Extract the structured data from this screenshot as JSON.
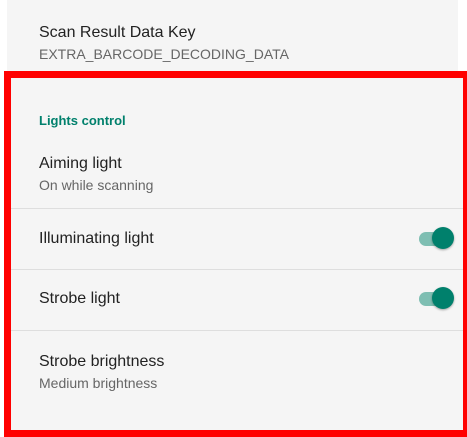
{
  "top_preference": {
    "title": "Scan Result Data Key",
    "summary": "EXTRA_BARCODE_DECODING_DATA"
  },
  "lights_control": {
    "category_title": "Lights control",
    "aiming_light": {
      "title": "Aiming light",
      "summary": "On while scanning"
    },
    "illuminating_light": {
      "title": "Illuminating light",
      "enabled": true
    },
    "strobe_light": {
      "title": "Strobe light",
      "enabled": true
    },
    "strobe_brightness": {
      "title": "Strobe brightness",
      "summary": "Medium brightness"
    }
  },
  "colors": {
    "accent": "#00806c",
    "switch_track": "#7ebeb2",
    "highlight_border": "#ff0000",
    "background": "#f5f5f5"
  }
}
